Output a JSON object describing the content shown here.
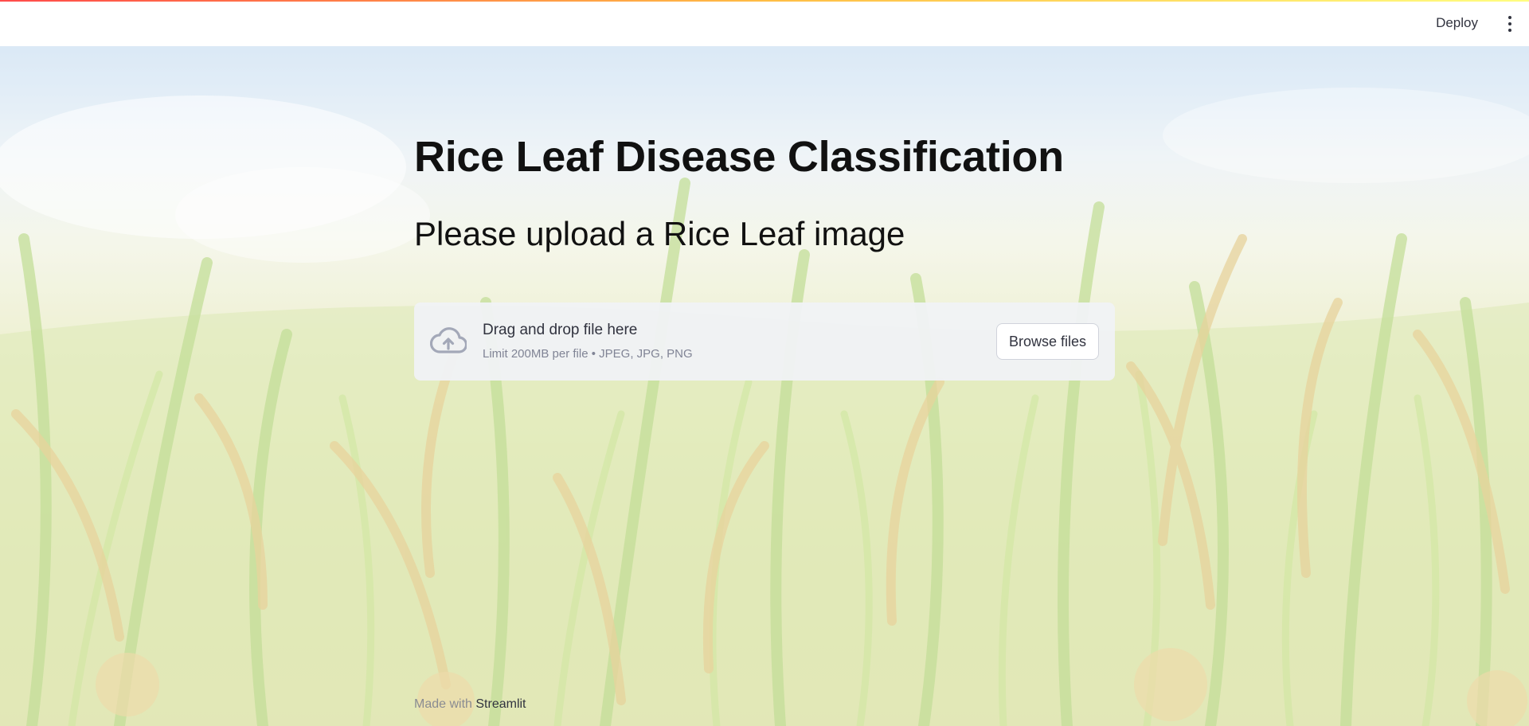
{
  "app": {
    "deploy_label": "Deploy",
    "menu_icon": "kebab-menu-icon"
  },
  "main": {
    "title": "Rice Leaf Disease Classification",
    "subtitle": "Please upload a Rice Leaf image"
  },
  "uploader": {
    "icon": "cloud-upload-icon",
    "drop_label": "Drag and drop file here",
    "limit_text": "Limit 200MB per file • JPEG, JPG, PNG",
    "browse_label": "Browse files"
  },
  "footer": {
    "made_with": "Made with",
    "brand": "Streamlit"
  },
  "colors": {
    "accent_gradient_start": "#ff4b4b",
    "accent_gradient_end": "#fffd80",
    "uploader_bg": "#f0f2f6",
    "text": "#31333f"
  }
}
